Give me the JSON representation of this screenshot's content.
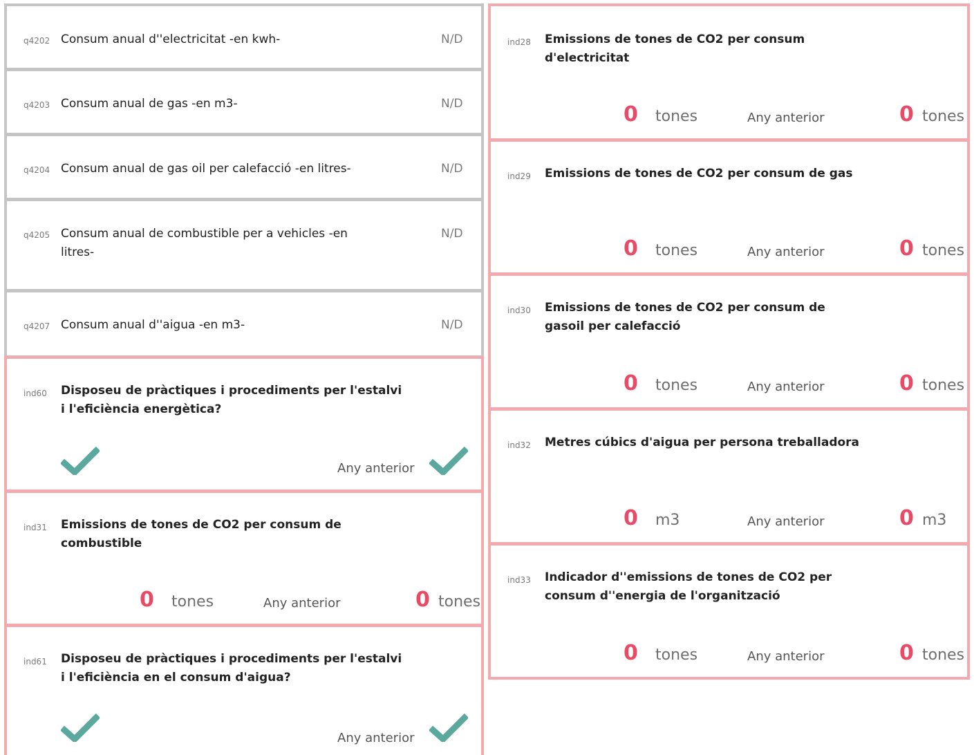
{
  "accent_color": "#e94a66",
  "check_color": "#5aa89e",
  "questions": [
    {
      "code": "q4202",
      "label": "Consum anual d''electricitat -en kwh-",
      "value": "N/D"
    },
    {
      "code": "q4203",
      "label": "Consum anual de gas -en m3-",
      "value": "N/D"
    },
    {
      "code": "q4204",
      "label": "Consum anual de gas oil per calefacció -en litres-",
      "value": "N/D"
    },
    {
      "code": "q4205",
      "label": "Consum anual de combustible per a vehicles -en litres-",
      "value": "N/D"
    },
    {
      "code": "q4207",
      "label": "Consum anual d''aigua -en m3-",
      "value": "N/D"
    }
  ],
  "indicators_left": [
    {
      "code": "ind60",
      "label": "Disposeu de pràctiques i procediments per l'estalvi i l'eficiència energètica?",
      "type": "check",
      "current": "check-icon",
      "previous_label": "Any anterior",
      "previous": "check-icon"
    },
    {
      "code": "ind31",
      "label": "Emissions de tones de CO2 per consum de combustible",
      "type": "number",
      "value": "0",
      "unit": "tones",
      "previous_label": "Any anterior",
      "previous_value": "0",
      "previous_unit": "tones"
    },
    {
      "code": "ind61",
      "label": "Disposeu de pràctiques i procediments per l'estalvi i l'eficiència en el consum d'aigua?",
      "type": "check",
      "current": "check-icon",
      "previous_label": "Any anterior",
      "previous": "check-icon"
    }
  ],
  "indicators_right": [
    {
      "code": "ind28",
      "label": "Emissions de tones de CO2 per consum d'electricitat",
      "value": "0",
      "unit": "tones",
      "previous_label": "Any anterior",
      "previous_value": "0",
      "previous_unit": "tones"
    },
    {
      "code": "ind29",
      "label": "Emissions de tones de CO2 per consum de gas",
      "value": "0",
      "unit": "tones",
      "previous_label": "Any anterior",
      "previous_value": "0",
      "previous_unit": "tones"
    },
    {
      "code": "ind30",
      "label": "Emissions de tones de CO2 per consum de gasoil per calefacció",
      "value": "0",
      "unit": "tones",
      "previous_label": "Any anterior",
      "previous_value": "0",
      "previous_unit": "tones"
    },
    {
      "code": "ind32",
      "label": "Metres cúbics d'aigua per persona treballadora",
      "value": "0",
      "unit": "m3",
      "previous_label": "Any anterior",
      "previous_value": "0",
      "previous_unit": "m3"
    },
    {
      "code": "ind33",
      "label": "Indicador d''emissions de tones de CO2 per consum d''energia de l'organització",
      "value": "0",
      "unit": "tones",
      "previous_label": "Any anterior",
      "previous_value": "0",
      "previous_unit": "tones"
    }
  ]
}
